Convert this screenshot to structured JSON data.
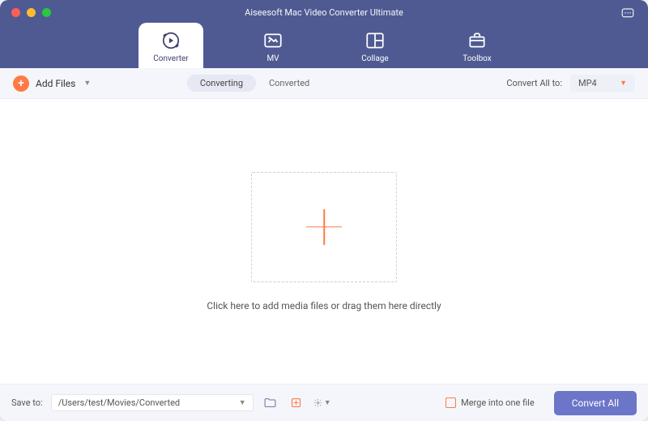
{
  "app_title": "Aiseesoft Mac Video Converter Ultimate",
  "tabs": {
    "converter": "Converter",
    "mv": "MV",
    "collage": "Collage",
    "toolbox": "Toolbox"
  },
  "toolbar": {
    "add_files": "Add Files",
    "segment_converting": "Converting",
    "segment_converted": "Converted",
    "convert_all_to_label": "Convert All to:",
    "format_selected": "MP4"
  },
  "main": {
    "hint": "Click here to add media files or drag them here directly"
  },
  "footer": {
    "save_to_label": "Save to:",
    "save_path": "/Users/test/Movies/Converted",
    "merge_label": "Merge into one file",
    "convert_all_button": "Convert All"
  }
}
